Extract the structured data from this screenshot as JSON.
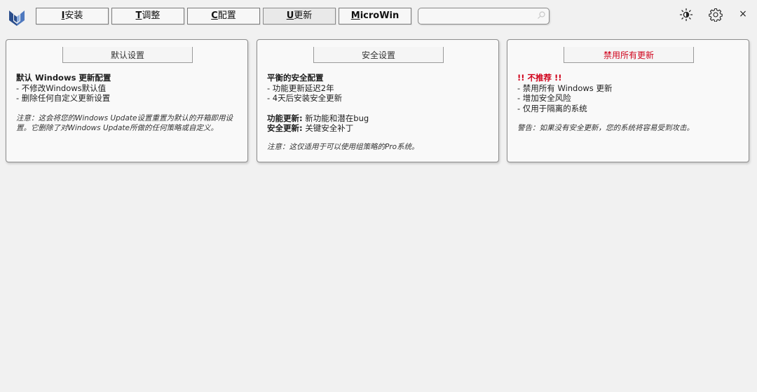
{
  "nav": {
    "install": {
      "mnemonic": "I",
      "label": "安装"
    },
    "tweaks": {
      "mnemonic": "T",
      "label": "调整"
    },
    "config": {
      "mnemonic": "C",
      "label": "配置"
    },
    "updates": {
      "mnemonic": "U",
      "label": "更新"
    },
    "microwin": {
      "mnemonic": "M",
      "label": "icroWin"
    }
  },
  "search": {
    "value": "",
    "placeholder": ""
  },
  "icons": {
    "logo": "winutil-logo-icon",
    "search": "search-icon",
    "theme": "sun-icon",
    "settings": "gear-icon",
    "close": "close-icon"
  },
  "close_label": "×",
  "colors": {
    "accent": "#2b4e8c",
    "danger": "#d0021b",
    "background": "#f1f1f1"
  },
  "cards": {
    "default": {
      "button": "默认设置",
      "title": "默认 Windows 更新配置",
      "items": [
        "- 不修改Windows默认值",
        "- 删除任何自定义更新设置"
      ],
      "note": "注意：这会将您的Windows Update设置重置为默认的开箱即用设置。它删除了对Windows Update所做的任何策略或自定义。"
    },
    "security": {
      "button": "安全设置",
      "title": "平衡的安全配置",
      "items": [
        "- 功能更新延迟2年",
        "- 4天后安装安全更新"
      ],
      "feature_label": "功能更新:",
      "feature_text": " 新功能和潜在bug",
      "security_label": "安全更新:",
      "security_text": " 关键安全补丁",
      "note": "注意：这仅适用于可以使用组策略的Pro系统。"
    },
    "disable": {
      "button": "禁用所有更新",
      "title": "!! 不推荐 !!",
      "items": [
        "- 禁用所有 Windows 更新",
        "- 增加安全风险",
        "- 仅用于隔离的系统"
      ],
      "note": "警告：如果没有安全更新，您的系统将容易受到攻击。"
    }
  }
}
